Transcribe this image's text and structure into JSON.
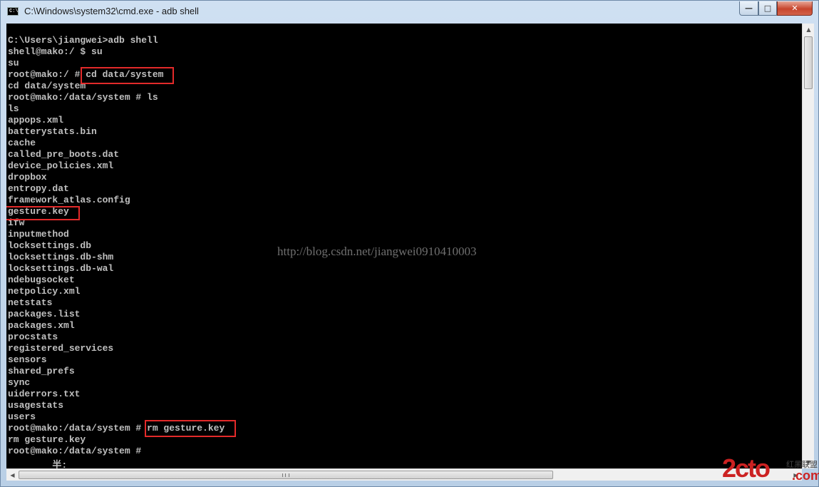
{
  "window": {
    "title": "C:\\Windows\\system32\\cmd.exe - adb  shell",
    "icon_label": "C:\\",
    "minimize_glyph": "—",
    "maximize_glyph": "□",
    "close_glyph": "✕"
  },
  "console": {
    "lines": [
      "C:\\Users\\jiangwei>adb shell",
      "shell@mako:/ $ su",
      "su",
      "root@mako:/ # cd data/system",
      "cd data/system",
      "root@mako:/data/system # ls",
      "ls",
      "appops.xml",
      "batterystats.bin",
      "cache",
      "called_pre_boots.dat",
      "device_policies.xml",
      "dropbox",
      "entropy.dat",
      "framework_atlas.config",
      "gesture.key",
      "ifw",
      "inputmethod",
      "locksettings.db",
      "locksettings.db-shm",
      "locksettings.db-wal",
      "ndebugsocket",
      "netpolicy.xml",
      "netstats",
      "packages.list",
      "packages.xml",
      "procstats",
      "registered_services",
      "sensors",
      "shared_prefs",
      "sync",
      "uiderrors.txt",
      "usagestats",
      "users",
      "root@mako:/data/system # rm gesture.key",
      "rm gesture.key",
      "root@mako:/data/system #",
      "        半:"
    ],
    "watermark": "http://blog.csdn.net/jiangwei0910410003",
    "highlight_color": "#e32a2a",
    "text_color": "#c0c0c0",
    "background_color": "#000000"
  },
  "scrollbars": {
    "up_glyph": "▲",
    "down_glyph": "▼",
    "left_glyph": "◀",
    "right_glyph": "▶"
  },
  "logo": {
    "main": "2cto",
    "small": "红黑联盟",
    "sub": ".com"
  }
}
